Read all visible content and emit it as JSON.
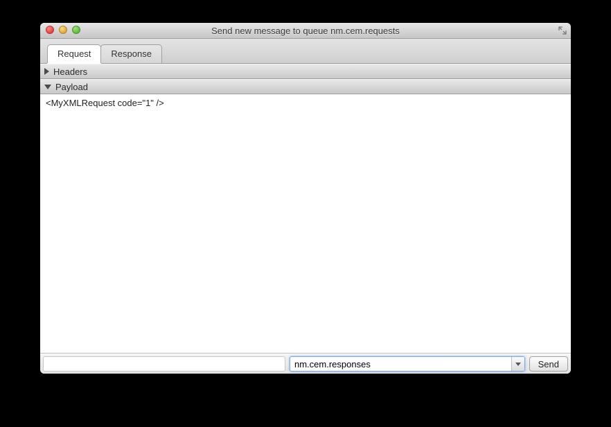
{
  "window": {
    "title": "Send new message to queue nm.cem.requests"
  },
  "tabs": {
    "request": "Request",
    "response": "Response"
  },
  "sections": {
    "headers": "Headers",
    "payload": "Payload"
  },
  "payload": {
    "value": "<MyXMLRequest code=\"1\" />"
  },
  "bottom": {
    "combo_value": "nm.cem.responses",
    "send_label": "Send"
  }
}
